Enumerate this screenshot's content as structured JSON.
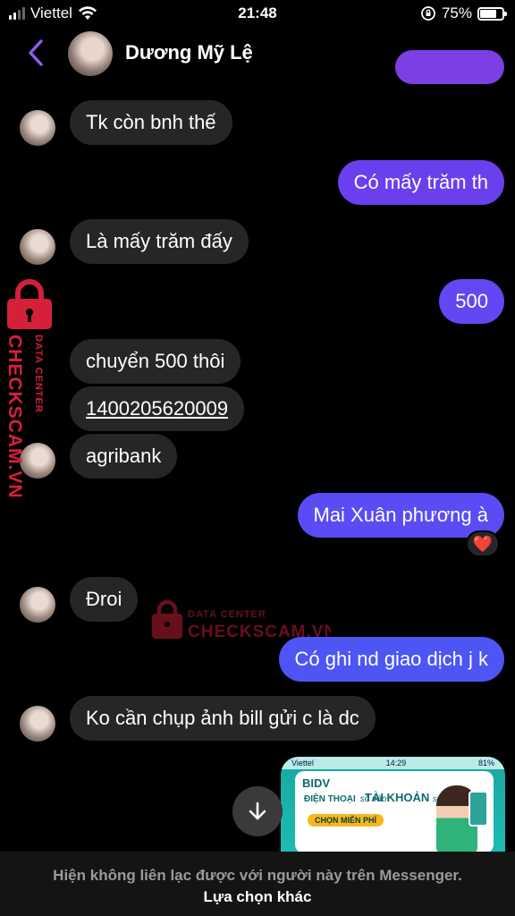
{
  "status_bar": {
    "carrier": "Viettel",
    "time": "21:48",
    "battery": "75%",
    "battery_level": 0.75
  },
  "header": {
    "contact_name": "Dương Mỹ Lệ"
  },
  "messages": [
    {
      "dir": "in",
      "text": "Tk còn bnh thế"
    },
    {
      "dir": "out",
      "text": "Có mấy trăm th"
    },
    {
      "dir": "in",
      "text": "Là mấy trăm đấy"
    },
    {
      "dir": "out",
      "text": "500"
    },
    {
      "dir": "in",
      "text": "chuyển 500 thôi"
    },
    {
      "dir": "in",
      "text": "1400205620009"
    },
    {
      "dir": "in",
      "text": "agribank"
    },
    {
      "dir": "out",
      "text": "Mai Xuân phương à"
    },
    {
      "dir": "in",
      "text": "Đroi"
    },
    {
      "dir": "out",
      "text": "Có ghi nd giao dịch j k"
    },
    {
      "dir": "in",
      "text": "Ko cần chụp ảnh bill gửi c là dc"
    }
  ],
  "reaction": "❤️",
  "watermark": {
    "label": "DATA CENTER",
    "brand": "CHECKSCAM.VN"
  },
  "attachment": {
    "status_carrier": "Viettel",
    "status_time": "14:29",
    "status_battery": "81%",
    "bank": "BIDV",
    "headline_left": "ĐIỆN THOẠI",
    "headline_left_sub": "số nào",
    "headline_right": "TÀI KHOẢN",
    "headline_right_sub": "số đó",
    "button": "CHỌN MIỄN PHÍ"
  },
  "footer": {
    "notice": "Hiện không liên lạc được với người này trên Messenger.",
    "action": "Lựa chọn khác"
  },
  "colors": {
    "outgoing_bubble": "#6e4cf2",
    "incoming_bubble": "#262628",
    "accent": "#8f5cf0",
    "watermark": "#d5203a"
  },
  "icons": [
    "back-chevron-icon",
    "wifi-icon",
    "signal-icon",
    "lock-icon",
    "battery-icon",
    "arrow-down-icon",
    "heart-icon"
  ]
}
